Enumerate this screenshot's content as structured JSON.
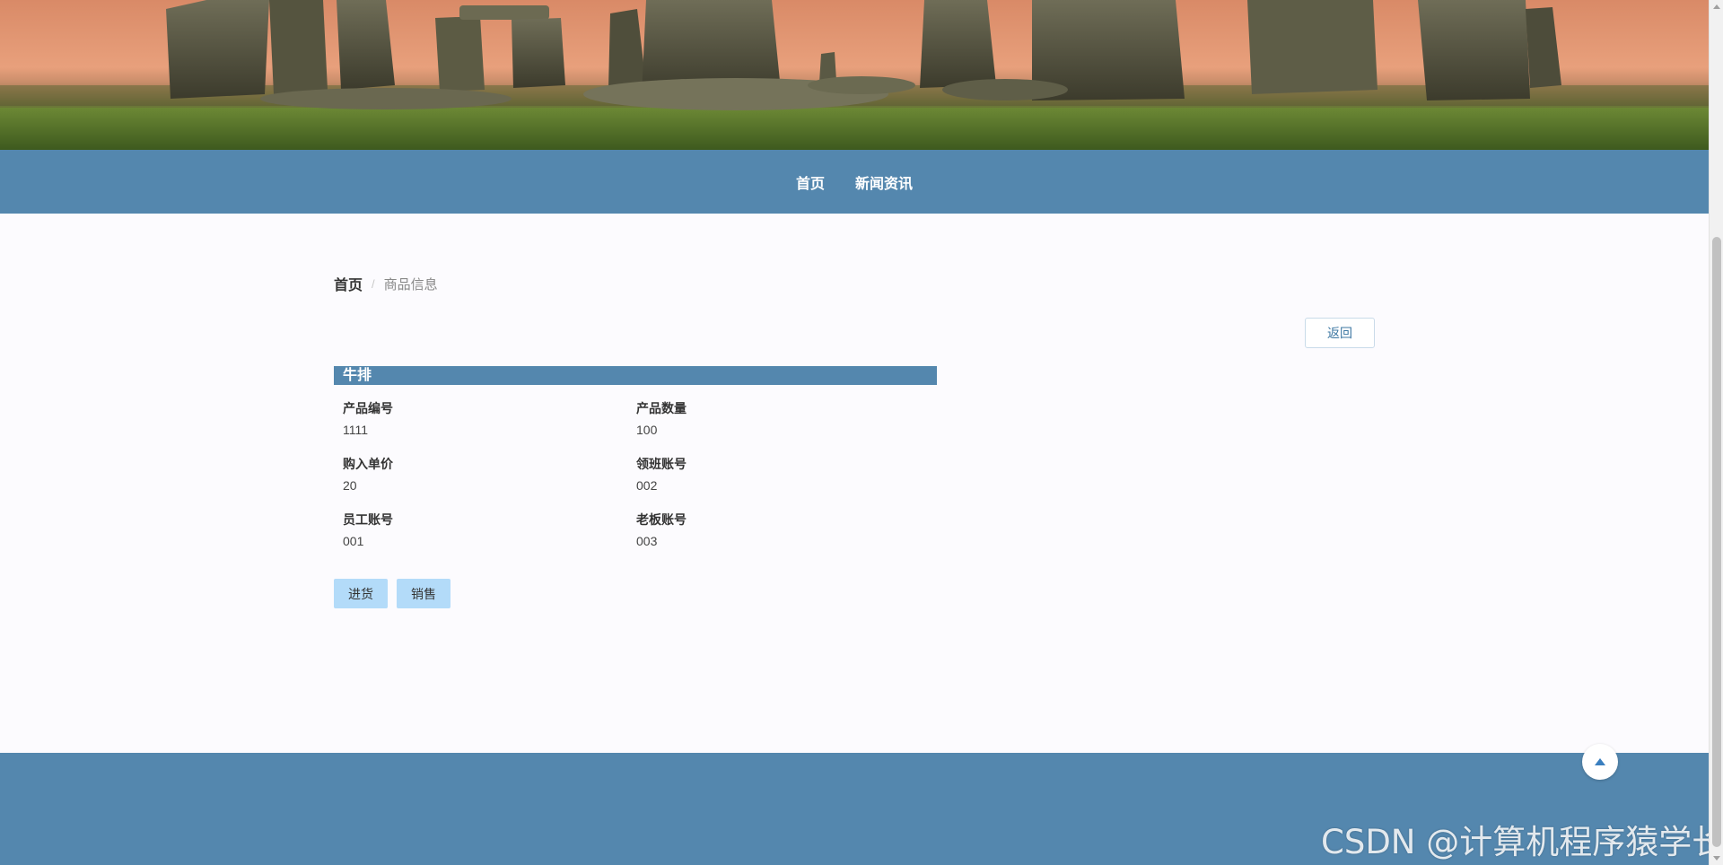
{
  "nav": {
    "items": [
      {
        "label": "首页"
      },
      {
        "label": "新闻资讯"
      }
    ]
  },
  "breadcrumb": {
    "home": "首页",
    "separator": "/",
    "current": "商品信息"
  },
  "back_button": "返回",
  "product": {
    "name": "牛排",
    "fields": [
      {
        "label": "产品编号",
        "value": "1111"
      },
      {
        "label": "产品数量",
        "value": "100"
      },
      {
        "label": "购入单价",
        "value": "20"
      },
      {
        "label": "领班账号",
        "value": "002"
      },
      {
        "label": "员工账号",
        "value": "001"
      },
      {
        "label": "老板账号",
        "value": "003"
      }
    ]
  },
  "actions": {
    "stock_in": "进货",
    "sell": "销售"
  },
  "watermark": "CSDN @计算机程序猿学长",
  "colors": {
    "primary": "#5487ae",
    "action_button": "#b3dbf9"
  },
  "icons": {
    "back_to_top": "caret-up-icon"
  }
}
